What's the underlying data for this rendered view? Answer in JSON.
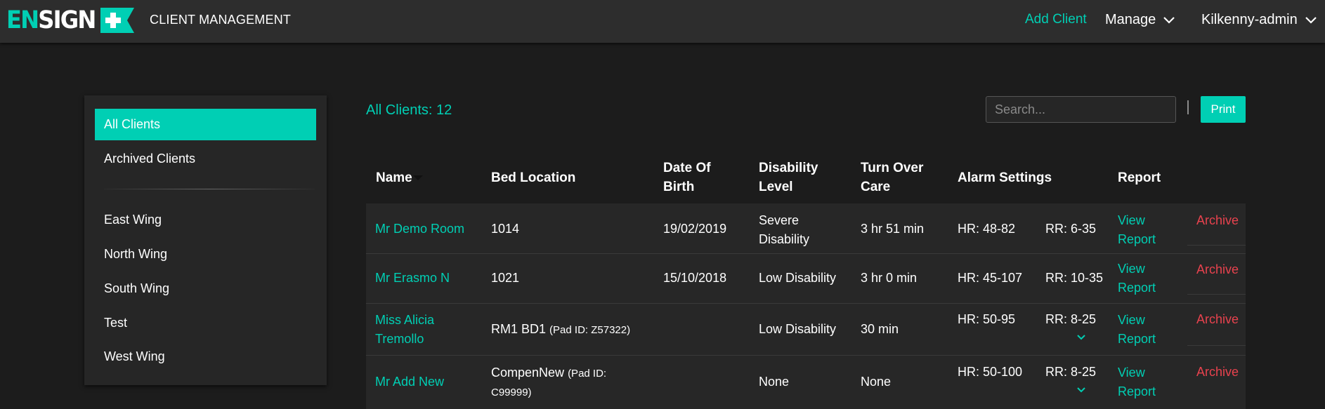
{
  "app": {
    "logo_en": "EN",
    "logo_sign": "SIGN",
    "title": "CLIENT MANAGEMENT",
    "accent": "#00cfb4",
    "danger": "#e8424e"
  },
  "nav": {
    "add_client": "Add Client",
    "manage": "Manage",
    "user": "Kilkenny-admin"
  },
  "sidebar": {
    "items": [
      {
        "label": "All Clients",
        "active": true
      },
      {
        "label": "Archived Clients",
        "active": false
      }
    ],
    "wings": [
      {
        "label": "East Wing"
      },
      {
        "label": "North Wing"
      },
      {
        "label": "South Wing"
      },
      {
        "label": "Test"
      },
      {
        "label": "West Wing"
      }
    ]
  },
  "main": {
    "count_label": "All Clients: 12",
    "search_placeholder": "Search...",
    "print_label": "Print"
  },
  "table": {
    "headers": {
      "name": "Name",
      "bed": "Bed Location",
      "dob_1": "Date Of",
      "dob_2": "Birth",
      "dis_1": "Disability",
      "dis_2": "Level",
      "turn_1": "Turn Over",
      "turn_2": "Care",
      "alarm": "Alarm Settings",
      "report": "Report"
    },
    "rows": [
      {
        "name_1": "Mr Demo Room",
        "name_2": "",
        "bed": "1014",
        "pad": "",
        "pad_2": "",
        "dob": "19/02/2019",
        "dis_1": "Severe",
        "dis_2": "Disability",
        "turn": "3 hr 51 min",
        "hr": "HR: 48-82",
        "rr": "RR: 6-35",
        "expand": false,
        "report_1": "View",
        "report_2": "Report",
        "archive": "Archive"
      },
      {
        "name_1": "Mr Erasmo N",
        "name_2": "",
        "bed": "1021",
        "pad": "",
        "pad_2": "",
        "dob": "15/10/2018",
        "dis_1": "Low Disability",
        "dis_2": "",
        "turn": "3 hr 0 min",
        "hr": "HR: 45-107",
        "rr": "RR: 10-35",
        "expand": false,
        "report_1": "View",
        "report_2": "Report",
        "archive": "Archive"
      },
      {
        "name_1": "Miss Alicia",
        "name_2": "Tremollo",
        "bed": "RM1 BD1",
        "pad": "(Pad ID: Z57322)",
        "pad_2": "",
        "dob": "",
        "dis_1": "Low Disability",
        "dis_2": "",
        "turn": "30 min",
        "hr": "HR: 50-95",
        "rr": "RR: 8-25",
        "expand": true,
        "report_1": "View",
        "report_2": "Report",
        "archive": "Archive"
      },
      {
        "name_1": "Mr Add New",
        "name_2": "",
        "bed": "CompenNew",
        "pad": "(Pad ID:",
        "pad_2": "C99999)",
        "dob": "",
        "dis_1": "None",
        "dis_2": "",
        "turn": "None",
        "hr": "HR: 50-100",
        "rr": "RR: 8-25",
        "expand": true,
        "report_1": "View",
        "report_2": "Report",
        "archive": "Archive"
      }
    ]
  }
}
